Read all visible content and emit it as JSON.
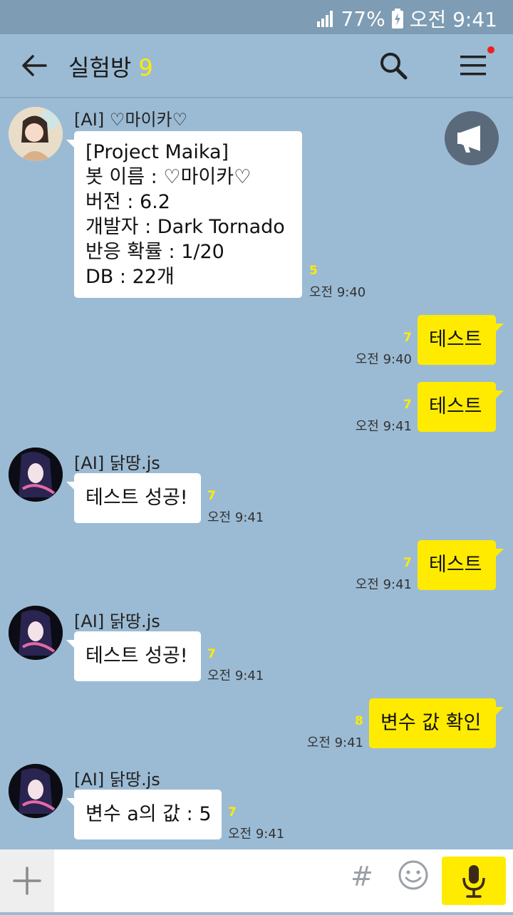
{
  "status": {
    "battery": "77%",
    "time": "오전 9:41"
  },
  "header": {
    "title": "실험방",
    "member_count": "9"
  },
  "messages": [
    {
      "sender": "[AI] ♡마이카♡",
      "lines": [
        "[Project Maika]",
        "봇 이름 : ♡마이카♡",
        "버전 : 6.2",
        "개발자 : Dark Tornado",
        "반응 확률 : 1/20",
        "DB : 22개"
      ],
      "unread": "5",
      "time": "오전 9:40"
    },
    {
      "text": "테스트",
      "unread": "7",
      "time": "오전 9:40"
    },
    {
      "text": "테스트",
      "unread": "7",
      "time": "오전 9:41"
    },
    {
      "sender": "[AI] 닭땅.js",
      "text": "테스트 성공!",
      "unread": "7",
      "time": "오전 9:41"
    },
    {
      "text": "테스트",
      "unread": "7",
      "time": "오전 9:41"
    },
    {
      "sender": "[AI] 닭땅.js",
      "text": "테스트 성공!",
      "unread": "7",
      "time": "오전 9:41"
    },
    {
      "text": "변수 값 확인",
      "unread": "8",
      "time": "오전 9:41"
    },
    {
      "sender": "[AI] 닭땅.js",
      "text": "변수 a의 값 : 5",
      "unread": "7",
      "time": "오전 9:41"
    }
  ],
  "input": {
    "placeholder": "",
    "hash": "#"
  },
  "colors": {
    "background": "#9bbbd4",
    "my_bubble": "#ffeb00",
    "other_bubble": "#ffffff",
    "unread": "#ffeb00"
  },
  "icons": [
    "back-arrow-icon",
    "search-icon",
    "menu-icon",
    "megaphone-icon",
    "plus-icon",
    "hash-icon",
    "emoji-icon",
    "mic-icon",
    "signal-icon",
    "battery-icon"
  ]
}
